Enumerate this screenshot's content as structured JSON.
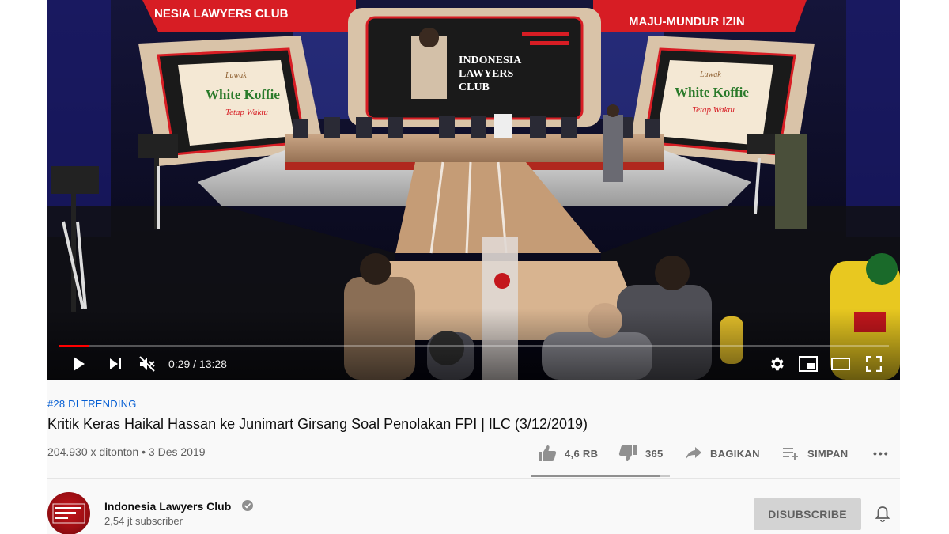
{
  "player": {
    "time_current": "0:29",
    "time_separator": " / ",
    "time_total": "13:28",
    "progress": 0.036,
    "icons": [
      "play-icon",
      "next-icon",
      "muted-icon",
      "settings-icon",
      "miniplayer-icon",
      "theater-icon",
      "fullscreen-icon"
    ],
    "screen": {
      "studio_logo_line1": "INDONESIA",
      "studio_logo_line2": "LAWYERS",
      "studio_logo_line3": "CLUB",
      "banner_left": "NESIA LAWYERS CLUB",
      "banner_right": "MAJU-MUNDUR IZIN",
      "sponsor_brand": "Luwak",
      "sponsor_name": "White Koffie",
      "sponsor_tagline": "Tetap Waktu"
    }
  },
  "video": {
    "trending_label": "#28 DI TRENDING",
    "title": "Kritik Keras Haikal Hassan ke Junimart Girsang Soal Penolakan FPI | ILC (3/12/2019)",
    "views": "204.930 x ditonton",
    "dot": " • ",
    "date": "3 Des 2019"
  },
  "actions": {
    "like_count": "4,6 RB",
    "dislike_count": "365",
    "share_label": "BAGIKAN",
    "save_label": "SIMPAN",
    "more_label": "•••",
    "like_ratio": 0.93
  },
  "channel": {
    "name": "Indonesia Lawyers Club",
    "subscribers": "2,54 jt subscriber",
    "avatar_text": "INDONESIA LAWYERS CLUB",
    "subscribe_label": "DISUBSCRIBE"
  },
  "colors": {
    "accent": "#ff0000",
    "link": "#065fd4",
    "channel_red": "#c4161c"
  }
}
